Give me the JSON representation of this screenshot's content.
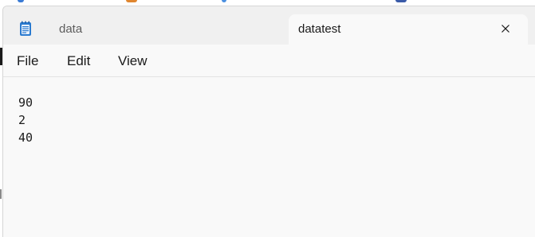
{
  "tabs": [
    {
      "label": "data",
      "active": false
    },
    {
      "label": "datatest",
      "active": true
    }
  ],
  "menu": {
    "file": "File",
    "edit": "Edit",
    "view": "View"
  },
  "editor": {
    "lines": [
      "90",
      "2",
      "40"
    ]
  },
  "icons": {
    "app": "notepad-icon",
    "close": "close-icon"
  },
  "colors": {
    "titlebar": "#f0f0f0",
    "editor_bg": "#f9f9f9",
    "icon_blue": "#2b7bd0"
  }
}
